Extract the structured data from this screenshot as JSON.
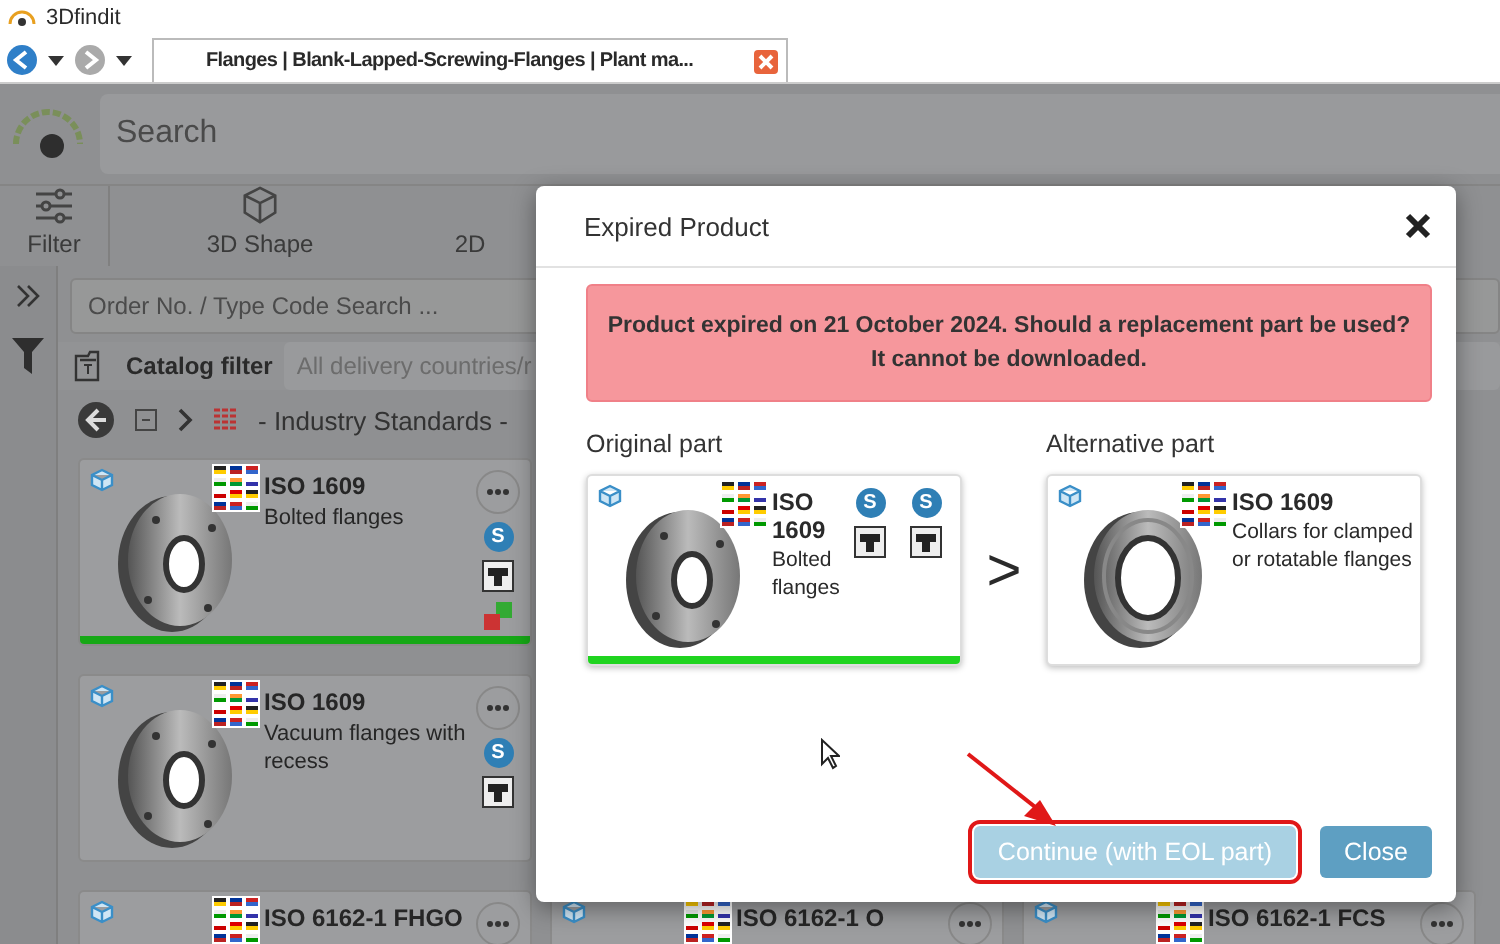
{
  "app_title": "3Dfindit",
  "browser": {
    "tab_title": "Flanges | Blank-Lapped-Screwing-Flanges | Plant ma..."
  },
  "search": {
    "placeholder": "Search"
  },
  "toolbar": [
    {
      "label": "Filter",
      "kind": "filter"
    },
    {
      "label": "3D Shape",
      "kind": "shape"
    },
    {
      "label": "2D",
      "kind": "plain"
    }
  ],
  "order_search": {
    "placeholder": "Order No. / Type Code Search ..."
  },
  "catalog_filter": {
    "label": "Catalog filter",
    "placeholder": "All delivery countries/r"
  },
  "breadcrumb": {
    "label": "- Industry Standards -"
  },
  "results": [
    {
      "title": "ISO 1609",
      "description": "Bolted flanges",
      "selected": true,
      "badges": [
        {
          "kind": "supplier",
          "label": "S"
        },
        {
          "kind": "table"
        },
        {
          "kind": "variants"
        }
      ]
    },
    {
      "title": "ISO 1609",
      "description": "Vacuum flanges with recess",
      "selected": false,
      "badges": [
        {
          "kind": "supplier",
          "label": "S"
        },
        {
          "kind": "table"
        }
      ]
    },
    {
      "title": "ISO 6162-1 FHGO"
    },
    {
      "title": "ISO 6162-1 O"
    },
    {
      "title": "ISO 6162-1 FCS"
    }
  ],
  "dialog": {
    "title": "Expired Product",
    "message": "Product expired on 21 October 2024. Should a replacement part be used? It cannot be downloaded.",
    "original": {
      "label": "Original part",
      "title": "ISO 1609",
      "description": "Bolted flanges",
      "selected": true,
      "badges": [
        {
          "kind": "supplier",
          "label": "S"
        },
        {
          "kind": "supplier",
          "label": "S"
        },
        {
          "kind": "table"
        },
        {
          "kind": "table"
        }
      ]
    },
    "separator": ">",
    "alternative": {
      "label": "Alternative part",
      "title": "ISO 1609",
      "description": "Collars for clamped or rotatable flanges",
      "selected": false
    },
    "buttons": [
      {
        "label": "Continue (with EOL part)",
        "kind": "secondary",
        "highlighted": true
      },
      {
        "label": "Close",
        "kind": "primary",
        "highlighted": false
      }
    ]
  }
}
